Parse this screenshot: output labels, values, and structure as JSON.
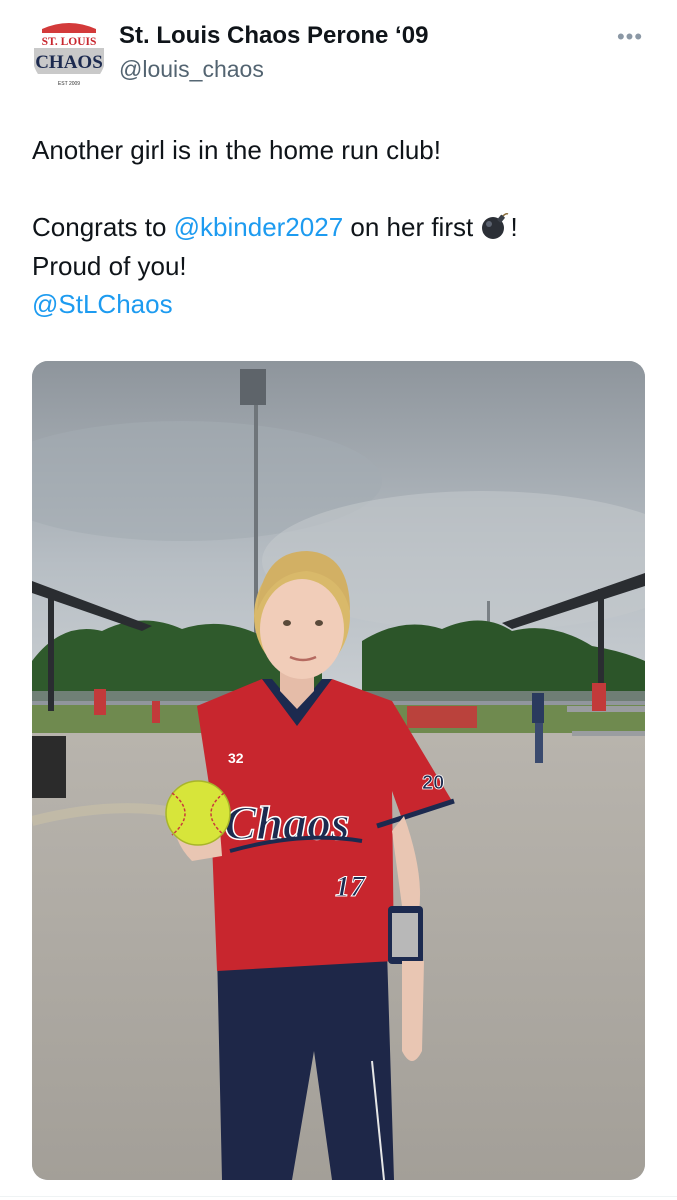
{
  "tweet": {
    "author": {
      "display_name": "St. Louis Chaos Perone ‘09",
      "handle": "@louis_chaos",
      "avatar_logo_text": [
        "ST. LOUIS",
        "CHAOS",
        "EST 2009"
      ]
    },
    "more_label": "•••",
    "text": {
      "line1": "Another girl is in the home run club!",
      "line2_prefix": "Congrats to ",
      "line2_mention": "@kbinder2027",
      "line2_suffix": " on her first ",
      "line2_end": "!",
      "line2_emoji": "bomb-emoji",
      "line3": "Proud of you!",
      "line4_mention": "@StLChaos"
    },
    "media": {
      "description_icon": "photo",
      "jersey_text": "Chaos",
      "jersey_number": "17",
      "jersey_brand": "32",
      "sleeve_number": "20"
    }
  },
  "colors": {
    "link": "#1d9bf0",
    "text": "#0f1419",
    "secondary": "#536471",
    "jersey_red": "#c8262e",
    "navy": "#1c2a4f"
  }
}
